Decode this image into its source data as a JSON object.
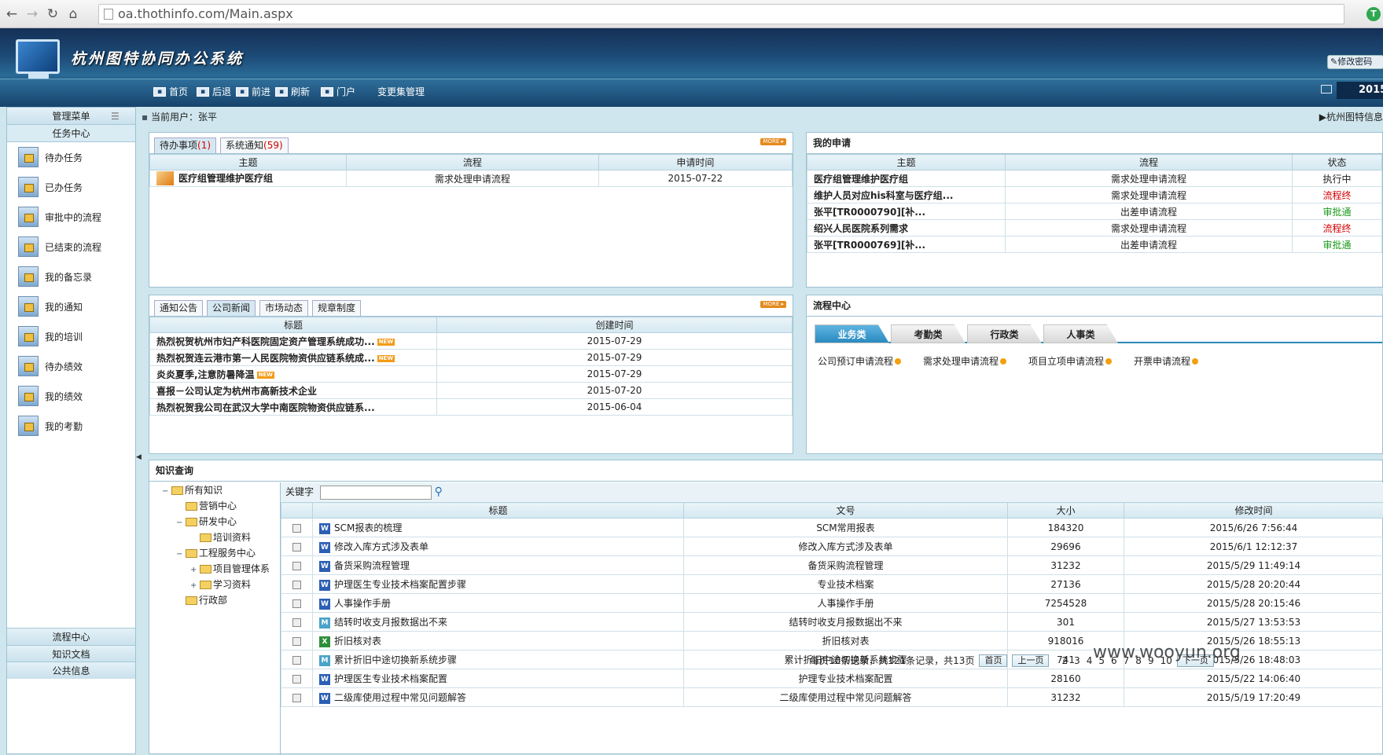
{
  "browser": {
    "url": "oa.thothinfo.com/Main.aspx",
    "ext": "T"
  },
  "app": {
    "title": "杭州图特协同办公系统",
    "change_pwd": "修改密码",
    "year": "2015",
    "toolbar": [
      {
        "icon": "home-icon",
        "label": "首页"
      },
      {
        "icon": "back-icon",
        "label": "后退"
      },
      {
        "icon": "forward-icon",
        "label": "前进"
      },
      {
        "icon": "refresh-icon",
        "label": "刷新"
      },
      {
        "icon": "portal-icon",
        "label": "门户"
      },
      {
        "icon": "",
        "label": "变更集管理"
      }
    ]
  },
  "sidebar": {
    "header": "管理菜单",
    "section": "任务中心",
    "items": [
      "待办任务",
      "已办任务",
      "审批中的流程",
      "已结束的流程",
      "我的备忘录",
      "我的通知",
      "我的培训",
      "待办绩效",
      "我的绩效",
      "我的考勤"
    ],
    "bottom": [
      "流程中心",
      "知识文档",
      "公共信息"
    ]
  },
  "userbar": {
    "current_user": "当前用户：张平",
    "right": "▶杭州图特信息"
  },
  "todo": {
    "tabs": [
      {
        "label": "待办事项",
        "count": "(1)"
      },
      {
        "label": "系统通知",
        "count": "(59)"
      }
    ],
    "more": "MORE ▸",
    "headers": [
      "主题",
      "流程",
      "申请时间"
    ],
    "rows": [
      [
        "医疗组管理维护医疗组",
        "需求处理申请流程",
        "2015-07-22"
      ]
    ]
  },
  "myapply": {
    "title": "我的申请",
    "headers": [
      "主题",
      "流程",
      "状态"
    ],
    "rows": [
      {
        "t": "医疗组管理维护医疗组",
        "p": "需求处理申请流程",
        "s": "执行中",
        "c": ""
      },
      {
        "t": "维护人员对应his科室与医疗组...",
        "p": "需求处理申请流程",
        "s": "流程终",
        "c": "red"
      },
      {
        "t": "张平[TR0000790][补...",
        "p": "出差申请流程",
        "s": "审批通",
        "c": "grn"
      },
      {
        "t": "绍兴人民医院系列需求",
        "p": "需求处理申请流程",
        "s": "流程终",
        "c": "red"
      },
      {
        "t": "张平[TR0000769][补...",
        "p": "出差申请流程",
        "s": "审批通",
        "c": "grn"
      }
    ]
  },
  "news": {
    "tabs": [
      "通知公告",
      "公司新闻",
      "市场动态",
      "规章制度"
    ],
    "more": "MORE ▸",
    "headers": [
      "标题",
      "创建时间"
    ],
    "rows": [
      {
        "t": "热烈祝贺杭州市妇产科医院固定资产管理系统成功...",
        "d": "2015-07-29",
        "n": true
      },
      {
        "t": "热烈祝贺连云港市第一人民医院物资供应链系统成...",
        "d": "2015-07-29",
        "n": true
      },
      {
        "t": "炎炎夏季,注意防暑降温",
        "d": "2015-07-29",
        "n": true
      },
      {
        "t": "喜报－公司认定为杭州市高新技术企业",
        "d": "2015-07-20",
        "n": false
      },
      {
        "t": "热烈祝贺我公司在武汉大学中南医院物资供应链系...",
        "d": "2015-06-04",
        "n": false
      }
    ],
    "new_label": "NEW"
  },
  "flow": {
    "title": "流程中心",
    "tabs": [
      "业务类",
      "考勤类",
      "行政类",
      "人事类"
    ],
    "links": [
      "公司预订申请流程",
      "需求处理申请流程",
      "项目立项申请流程",
      "开票申请流程"
    ]
  },
  "knowledge": {
    "title": "知识查询",
    "keyword_label": "关键字",
    "tree": [
      {
        "l": "所有知识",
        "lvl": 0,
        "e": "−"
      },
      {
        "l": "营销中心",
        "lvl": 1,
        "e": ""
      },
      {
        "l": "研发中心",
        "lvl": 1,
        "e": "−"
      },
      {
        "l": "培训资料",
        "lvl": 2,
        "e": ""
      },
      {
        "l": "工程服务中心",
        "lvl": 1,
        "e": "−"
      },
      {
        "l": "项目管理体系",
        "lvl": 2,
        "e": "+"
      },
      {
        "l": "学习资料",
        "lvl": 2,
        "e": "+"
      },
      {
        "l": "行政部",
        "lvl": 1,
        "e": ""
      }
    ],
    "headers": [
      "标题",
      "文号",
      "大小",
      "修改时间"
    ],
    "rows": [
      {
        "i": "W",
        "t": "SCM报表的梳理",
        "n": "SCM常用报表",
        "s": "184320",
        "m": "2015/6/26 7:56:44"
      },
      {
        "i": "W",
        "t": "修改入库方式涉及表单",
        "n": "修改入库方式涉及表单",
        "s": "29696",
        "m": "2015/6/1 12:12:37"
      },
      {
        "i": "W",
        "t": "备货采购流程管理",
        "n": "备货采购流程管理",
        "s": "31232",
        "m": "2015/5/29 11:49:14"
      },
      {
        "i": "W",
        "t": "护理医生专业技术档案配置步骤",
        "n": "专业技术档案",
        "s": "27136",
        "m": "2015/5/28 20:20:44"
      },
      {
        "i": "W",
        "t": "人事操作手册",
        "n": "人事操作手册",
        "s": "7254528",
        "m": "2015/5/28 20:15:46"
      },
      {
        "i": "M",
        "t": "结转时收支月报数据出不来",
        "n": "结转时收支月报数据出不来",
        "s": "301",
        "m": "2015/5/27 13:53:53"
      },
      {
        "i": "X",
        "t": "折旧核对表",
        "n": "折旧核对表",
        "s": "918016",
        "m": "2015/5/26 18:55:13"
      },
      {
        "i": "M",
        "t": "累计折旧中途切换新系统步骤",
        "n": "累计折旧中途切换新系统步骤",
        "s": "741",
        "m": "2015/5/26 18:48:03"
      },
      {
        "i": "W",
        "t": "护理医生专业技术档案配置",
        "n": "护理专业技术档案配置",
        "s": "28160",
        "m": "2015/5/22 14:06:40"
      },
      {
        "i": "W",
        "t": "二级库使用过程中常见问题解答",
        "n": "二级库使用过程中常见问题解答",
        "s": "31232",
        "m": "2015/5/19 17:20:49"
      }
    ],
    "pager": {
      "summary": "每页10条记录，共121条记录，共13页",
      "first": "首页",
      "prev": "上一页",
      "next": "下一页",
      "pages": [
        "2",
        "3",
        "4",
        "5",
        "6",
        "7",
        "8",
        "9",
        "10"
      ]
    }
  },
  "watermark": "www.wooyun.org"
}
